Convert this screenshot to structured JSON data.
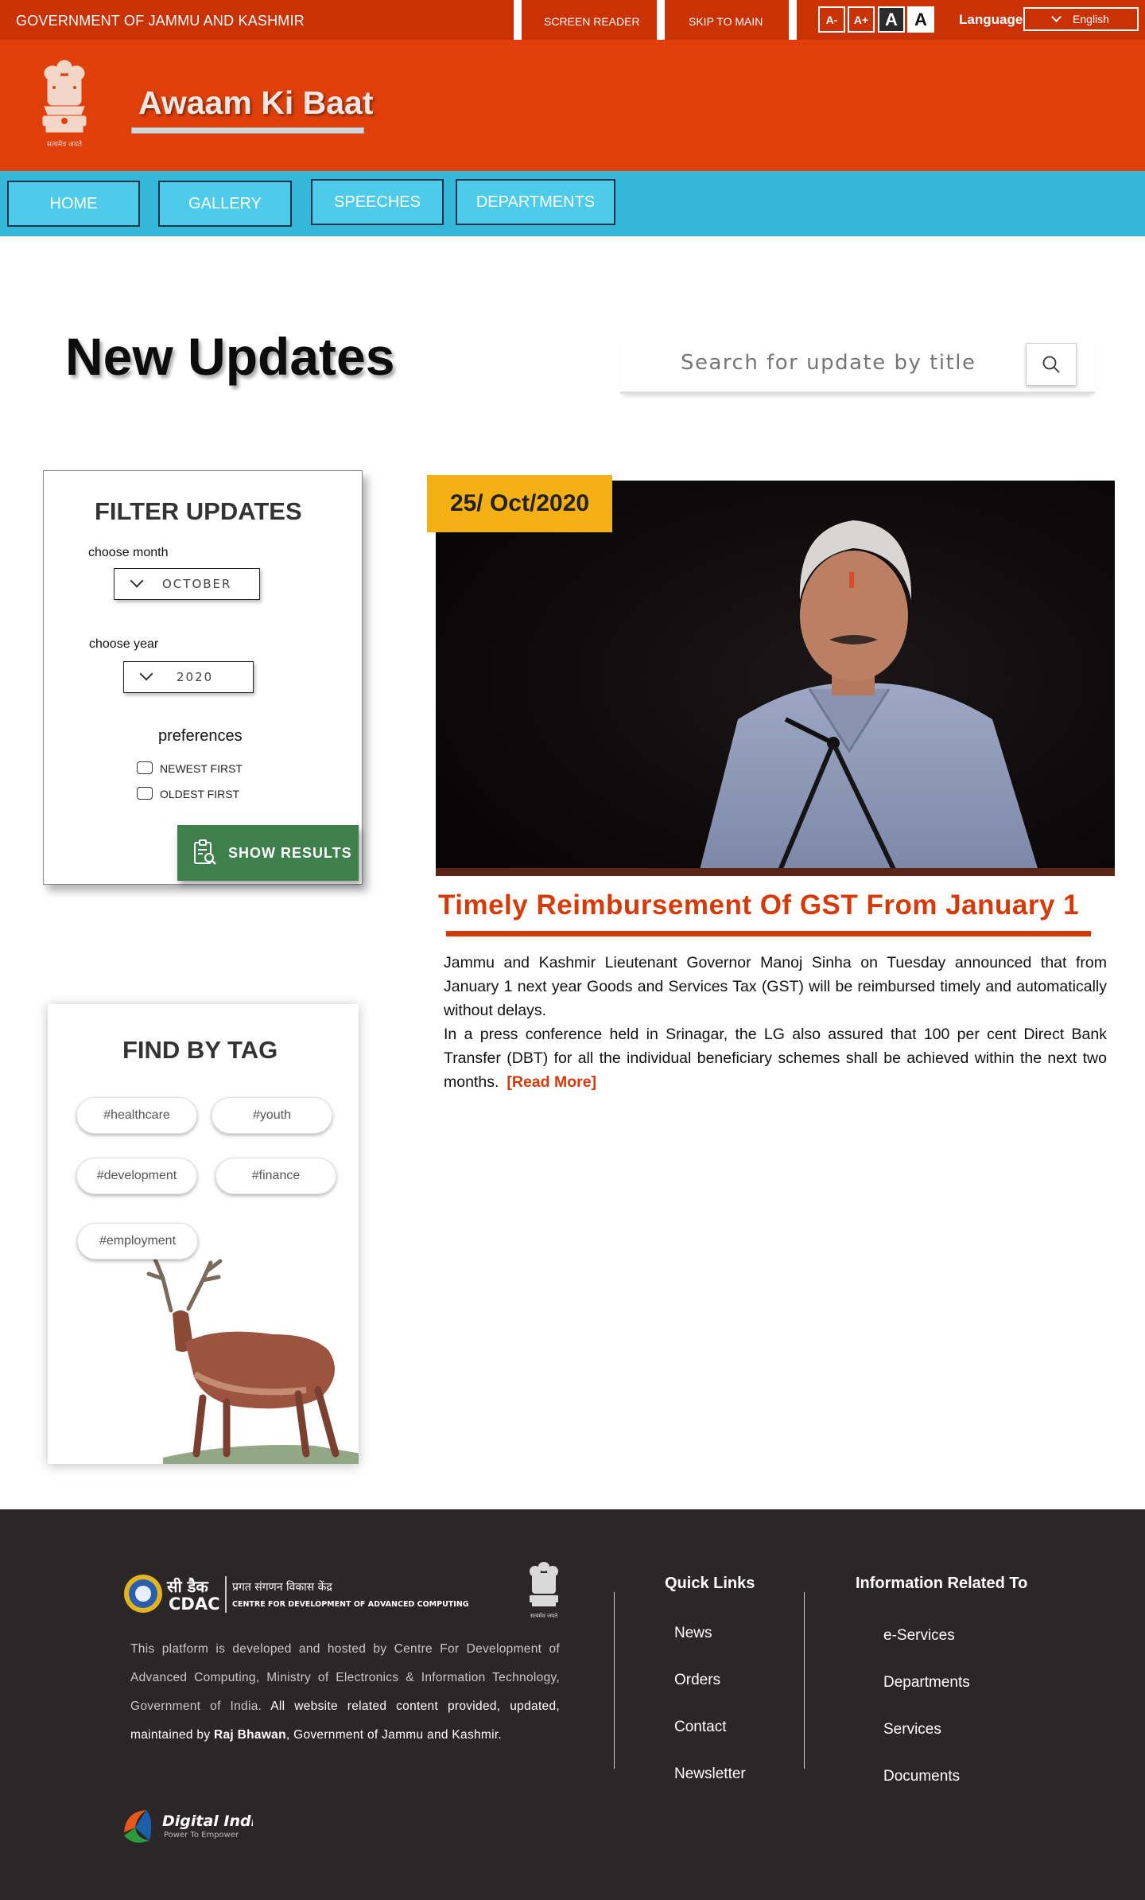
{
  "topbar": {
    "gov_title": "GOVERNMENT OF JAMMU AND KASHMIR",
    "screen_reader": "SCREEN READER",
    "skip_to_main": "SKIP TO MAIN",
    "font_size_buttons": [
      "A-",
      "A+",
      "A",
      "A"
    ],
    "language_label": "Language",
    "language_value": "English"
  },
  "header": {
    "site_title": "Awaam Ki Baat",
    "emblem_motto": "सत्यमेव जयते"
  },
  "nav": {
    "items": [
      "HOME",
      "GALLERY",
      "SPEECHES",
      "DEPARTMENTS"
    ]
  },
  "main": {
    "page_title": "New Updates",
    "search_placeholder": "Search for update by title"
  },
  "filter": {
    "title": "FILTER UPDATES",
    "month_label": "choose month",
    "month_value": "OCTOBER",
    "year_label": "choose year",
    "year_value": "2020",
    "preferences_title": "preferences",
    "options": [
      "NEWEST FIRST",
      "OLDEST FIRST"
    ],
    "show_results": "SHOW RESULTS"
  },
  "tags": {
    "title": "FIND BY TAG",
    "items": [
      "#healthcare",
      "#youth",
      "#development",
      "#finance",
      "#employment"
    ]
  },
  "article": {
    "date": "25/ Oct/2020",
    "title": "Timely Reimbursement Of GST From January 1",
    "paragraph1": "Jammu and Kashmir Lieutenant Governor Manoj Sinha on Tuesday announced that from January 1 next year Goods and Services Tax (GST) will be reimbursed timely and automatically without delays.",
    "paragraph2": "In a press conference held in Srinagar, the LG also assured that 100 per cent Direct Bank Transfer (DBT) for all the individual beneficiary schemes shall be achieved within the next two months.",
    "read_more": "[Read More]"
  },
  "footer": {
    "cdac_hindi": "सी डैक",
    "cdac_hindi_full": "प्रगत संगणन विकास केंद्र",
    "cdac_english": "CENTRE FOR DEVELOPMENT OF ADVANCED COMPUTING",
    "cdac_short": "CDAC",
    "about_grey": "This platform is developed and hosted by Centre For Development of Advanced Computing, Ministry of Electronics & Information Technology, Government of India.",
    "about_white1": "All website related content provided, updated, maintained  by",
    "about_bold": "Raj Bhawan",
    "about_white2": ", Government of Jammu and Kashmir.",
    "quick_links_title": "Quick Links",
    "quick_links": [
      "News",
      "Orders",
      "Contact",
      "Newsletter"
    ],
    "info_title": "Information Related To",
    "info_links": [
      "e-Services",
      "Departments",
      "Services",
      "Documents"
    ],
    "digital_india": "Digital India",
    "digital_india_tagline": "Power To Empower"
  },
  "colors": {
    "topbar": "#c93205",
    "header": "#df3f0b",
    "nav": "#33b8d9",
    "nav_button": "#4ecbeb",
    "accent": "#d53a0a",
    "date_badge": "#f5b014",
    "show_results": "#3e7f4c",
    "footer": "#2b2627"
  }
}
